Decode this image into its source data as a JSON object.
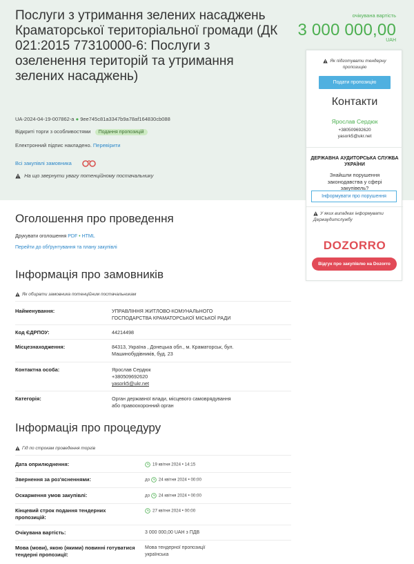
{
  "tender": {
    "title": "Послуги з утримання зелених насаджень Краматорської територіальної громади (ДК 021:2015 77310000-6: Послуги з озеленення територій та утримання зелених насаджень)",
    "id_line": "UA-2024-04-19-007862-a",
    "hash": "9ee745c81a3347b9a78af164830cb088",
    "procedure_type": "Відкриті торги з особливостями",
    "status_badge": "Подання пропозицій",
    "signature_text": "Електронний підпис накладено.",
    "signature_link": "Перевірити",
    "all_purchases_link": "Всі закупівлі замовника",
    "attention_text": "На що звернути увагу потенційному постачальнику"
  },
  "price": {
    "label": "очікувана вартість",
    "amount": "3 000 000,00",
    "currency": "UAH"
  },
  "sidebar": {
    "prepare_link": "Як підготувати тендерну пропозицію",
    "submit_button": "Подати пропозицію",
    "contacts_heading": "Контакти",
    "contact_name": "Ярослав Сердюк",
    "contact_phone": "+380509692620",
    "contact_email": "yasork5@ukr.net",
    "audit_heading": "ДЕРЖАВНА АУДИТОРСЬКА СЛУЖБА УКРАЇНИ",
    "audit_question": "Знайшли порушення законодавства у сфері закупівель?",
    "report_button": "Інформувати про порушення",
    "dozorro_note": "У яких випадках інформувати Держаудитслужбу",
    "dozorro_logo": "DOZORRO",
    "feedback_button": "Відгук про закупівлю на Dozorro"
  },
  "announcement": {
    "heading": "Оголошення про проведення",
    "print_label": "Друкувати оголошення",
    "print_pdf": "PDF",
    "print_sep": "•",
    "print_html": "HTML",
    "plan_link": "Перейти до обґрунтування та плану закупівлі"
  },
  "customer": {
    "heading": "Інформація про замовників",
    "hint": "Як обирати замовника потенційним постачальникам",
    "rows": [
      {
        "label": "Найменування:",
        "value": "УПРАВЛІННЯ ЖИТЛОВО-КОМУНАЛЬНОГО ГОСПОДАРСТВА КРАМАТОРСЬКОЇ МІСЬКОЇ РАДИ"
      },
      {
        "label": "Код ЄДРПОУ:",
        "value": "44214498"
      },
      {
        "label": "Місцезнаходження:",
        "value": "84313, Україна , Донецька обл., м. Краматорськ, бул. Машинобудівників, буд. 23"
      },
      {
        "label": "Контактна особа:",
        "value": "Ярослав Сердюк"
      },
      {
        "label": "Категорія:",
        "value": "Орган державної влади, місцевого самоврядування або правоохоронний орган"
      }
    ],
    "contact_phone": "+380509692620",
    "contact_email": "yasork5@ukr.net"
  },
  "procedure": {
    "heading": "Інформація про процедуру",
    "hint": "Гід по строкам проведення торгів",
    "rows": [
      {
        "label": "Дата оприлюднення:",
        "prefix": "",
        "value": "19 квітня 2024  •  14:15"
      },
      {
        "label": "Звернення за роз'ясненнями:",
        "prefix": "до",
        "value": "24 квітня 2024  •  00:00"
      },
      {
        "label": "Оскарження умов закупівлі:",
        "prefix": "до",
        "value": "24 квітня 2024  •  00:00"
      },
      {
        "label": "Кінцевий строк подання тендерних пропозицій:",
        "prefix": "",
        "value": "27 квітня 2024  •  00:00"
      },
      {
        "label": "Очікувана вартість:",
        "prefix": "",
        "value": "3 000 000,00 UAH з ПДВ"
      },
      {
        "label": "Мова (мови), якою (якими) повинні готуватися тендерні пропозиції:",
        "prefix": "",
        "value": "Мова тендерної пропозиції українська"
      }
    ]
  },
  "colors": {
    "hero_bg": "#eaf1ec",
    "accent_green": "#4caf50",
    "link_blue": "#2a86c9",
    "button_blue": "#4fb0e0",
    "dozorro_red": "#e24a57"
  }
}
